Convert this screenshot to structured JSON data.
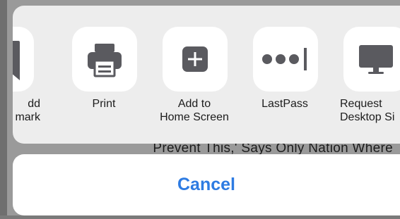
{
  "background_text": {
    "headline": "Prevent This,' Says Only Nation Where"
  },
  "share_actions": [
    {
      "label": "dd\nmark",
      "icon": "bookmark-icon"
    },
    {
      "label": "Print",
      "icon": "printer-icon"
    },
    {
      "label": "Add to\nHome Screen",
      "icon": "plus-square-icon"
    },
    {
      "label": "LastPass",
      "icon": "lastpass-icon"
    },
    {
      "label": "Request\nDesktop Si",
      "icon": "desktop-icon"
    }
  ],
  "cancel": {
    "label": "Cancel"
  },
  "colors": {
    "accent": "#2d7be2",
    "sheet": "#ededed",
    "tile": "#ffffff",
    "icon": "#5a5a5f"
  }
}
